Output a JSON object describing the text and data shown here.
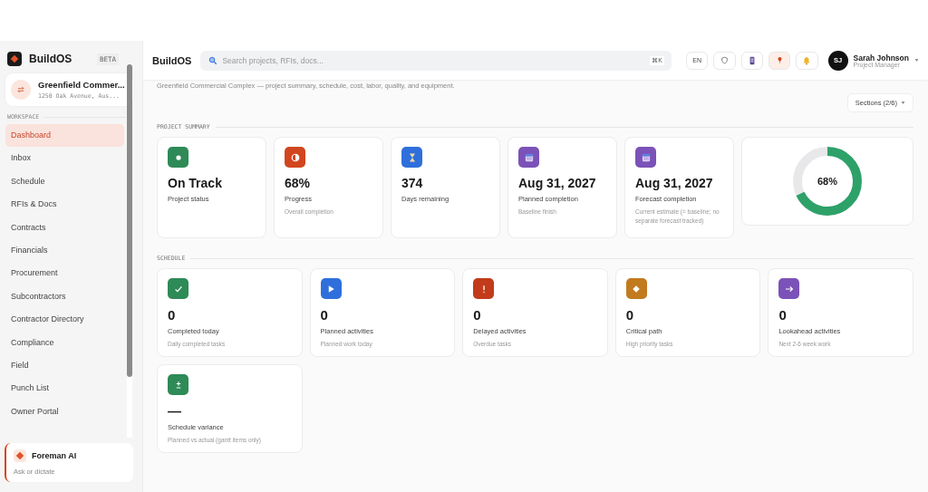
{
  "brand": {
    "name": "BuildOS",
    "badge": "BETA"
  },
  "project": {
    "name": "Greenfield Commer...",
    "address": "1250 Oak Avenue, Aus..."
  },
  "sidebar": {
    "section": "WORKSPACE",
    "items": [
      {
        "label": "Dashboard",
        "selected": true
      },
      {
        "label": "Inbox",
        "selected": false
      },
      {
        "label": "Schedule",
        "selected": false
      },
      {
        "label": "RFIs & Docs",
        "selected": false
      },
      {
        "label": "Contracts",
        "selected": false
      },
      {
        "label": "Financials",
        "selected": false
      },
      {
        "label": "Procurement",
        "selected": false
      },
      {
        "label": "Subcontractors",
        "selected": false
      },
      {
        "label": "Contractor Directory",
        "selected": false
      },
      {
        "label": "Compliance",
        "selected": false
      },
      {
        "label": "Field",
        "selected": false
      },
      {
        "label": "Punch List",
        "selected": false
      },
      {
        "label": "Owner Portal",
        "selected": false
      }
    ]
  },
  "assistant": {
    "title": "Foreman AI",
    "hint": "Ask or dictate"
  },
  "header": {
    "title": "BuildOS",
    "search": {
      "placeholder": "Search projects, RFIs, docs...",
      "shortcut": "⌘K"
    },
    "language": "EN",
    "user": {
      "initials": "SJ",
      "name": "Sarah Johnson",
      "role": "Project Manager"
    }
  },
  "subtitle": "Greenfield Commercial Complex — project summary, schedule, cost, labor, quality, and equipment.",
  "sections_button": "Sections (2/6)",
  "project_summary": {
    "heading": "PROJECT SUMMARY",
    "cards": [
      {
        "kind": "dot",
        "color": "#2e8a57",
        "value": "On Track",
        "label": "Project status"
      },
      {
        "kind": "half",
        "color": "#d2461f",
        "value": "68%",
        "label": "Progress",
        "note": "Overall completion"
      },
      {
        "kind": "hourglass",
        "color": "#2f6fdc",
        "value": "374",
        "label": "Days remaining"
      },
      {
        "kind": "calendar",
        "color": "#7b52b8",
        "value": "Aug 31, 2027",
        "label": "Planned completion",
        "note": "Baseline finish"
      },
      {
        "kind": "calendar",
        "color": "#7b52b8",
        "value": "Aug 31, 2027",
        "label": "Forecast completion",
        "note": "Current estimate (= baseline; no separate forecast tracked)"
      }
    ],
    "progress": {
      "level": 0.68,
      "reading": "68%"
    }
  },
  "schedule": {
    "heading": "SCHEDULE",
    "cards": [
      {
        "kind": "check",
        "color": "#2e8a57",
        "value": "0",
        "label": "Completed today",
        "note": "Daily completed tasks"
      },
      {
        "kind": "play",
        "color": "#2f6fdc",
        "value": "0",
        "label": "Planned activities",
        "note": "Planned work today"
      },
      {
        "kind": "alert",
        "color": "#c23b1a",
        "value": "0",
        "label": "Delayed activities",
        "note": "Overdue tasks"
      },
      {
        "kind": "diamond",
        "color": "#c27a1e",
        "value": "0",
        "label": "Critical path",
        "note": "High priority tasks"
      },
      {
        "kind": "arrow",
        "color": "#7b52b8",
        "value": "0",
        "label": "Lookahead activities",
        "note": "Next 2-6 week work"
      },
      {
        "kind": "plusminus",
        "color": "#2e8a57",
        "value": "—",
        "label": "Schedule variance",
        "note": "Planned vs actual (gantt items only)"
      }
    ]
  }
}
